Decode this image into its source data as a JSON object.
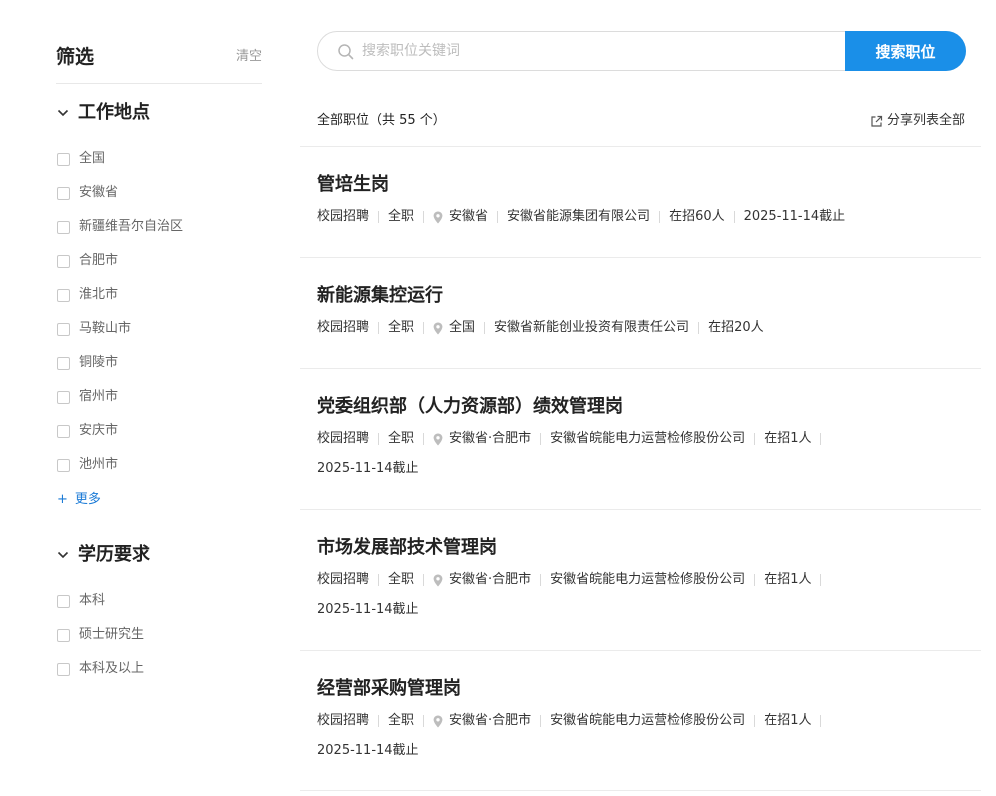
{
  "sidebar": {
    "title": "筛选",
    "clear_label": "清空",
    "location": {
      "title": "工作地点",
      "options": [
        "全国",
        "安徽省",
        "新疆维吾尔自治区",
        "合肥市",
        "淮北市",
        "马鞍山市",
        "铜陵市",
        "宿州市",
        "安庆市",
        "池州市"
      ],
      "more_label": "更多",
      "more_prefix": "+"
    },
    "education": {
      "title": "学历要求",
      "options": [
        "本科",
        "硕士研究生",
        "本科及以上"
      ]
    }
  },
  "search": {
    "placeholder": "搜索职位关键词",
    "value": "",
    "button_label": "搜索职位"
  },
  "results": {
    "count_label": "全部职位（共 55 个）",
    "share_label": "分享列表全部"
  },
  "jobs": [
    {
      "title": "管培生岗",
      "type": "校园招聘",
      "nature": "全职",
      "location": "安徽省",
      "company": "安徽省能源集团有限公司",
      "headcount": "在招60人",
      "deadline": "2025-11-14截止"
    },
    {
      "title": "新能源集控运行",
      "type": "校园招聘",
      "nature": "全职",
      "location": "全国",
      "company": "安徽省新能创业投资有限责任公司",
      "headcount": "在招20人",
      "deadline": ""
    },
    {
      "title": "党委组织部（人力资源部）绩效管理岗",
      "type": "校园招聘",
      "nature": "全职",
      "location": "安徽省·合肥市",
      "company": "安徽省皖能电力运营检修股份公司",
      "headcount": "在招1人",
      "deadline": "2025-11-14截止"
    },
    {
      "title": "市场发展部技术管理岗",
      "type": "校园招聘",
      "nature": "全职",
      "location": "安徽省·合肥市",
      "company": "安徽省皖能电力运营检修股份公司",
      "headcount": "在招1人",
      "deadline": "2025-11-14截止"
    },
    {
      "title": "经营部采购管理岗",
      "type": "校园招聘",
      "nature": "全职",
      "location": "安徽省·合肥市",
      "company": "安徽省皖能电力运营检修股份公司",
      "headcount": "在招1人",
      "deadline": "2025-11-14截止"
    }
  ],
  "colors": {
    "accent": "#1a8fe8",
    "link": "#1a7ad6",
    "divider": "#ebebeb",
    "muted_text": "#666666"
  },
  "icons": {
    "search": "search-icon",
    "chevron": "chevron-down-icon",
    "share": "share-icon",
    "location": "location-pin-icon"
  }
}
